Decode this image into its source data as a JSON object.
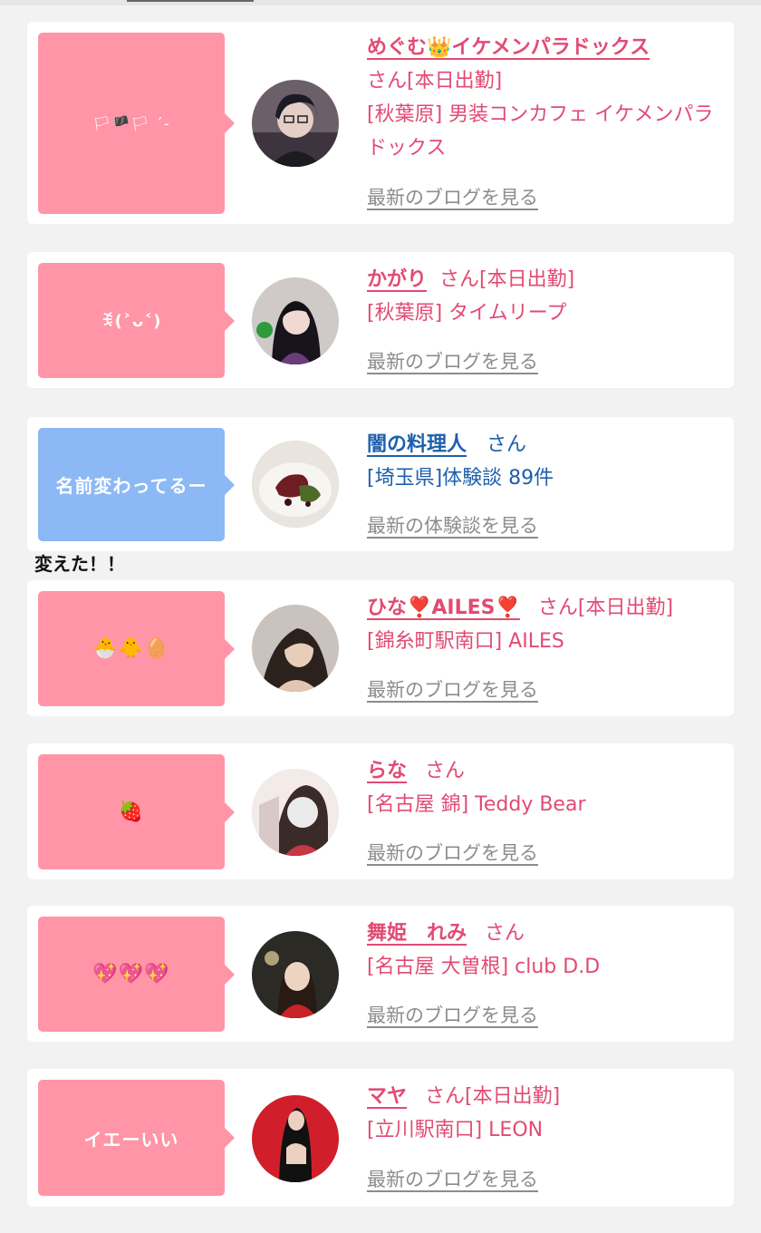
{
  "cards": [
    {
      "bubble_text": "🏳🏴🏳 ´-",
      "bubble_color": "#ff95a6",
      "name": "めぐむ👑イケメンパラドックス",
      "suffix": "さん[本日出勤]",
      "location": "[秋葉原] 男装コンカフェ イケメンパラドックス",
      "link": "最新のブログを見る"
    },
    {
      "bubble_text": "ꉂ(˃ᴗ˂)",
      "bubble_color": "#ff95a6",
      "name": "かがり",
      "suffix": "さん[本日出勤]",
      "location": "[秋葉原] タイムリープ",
      "link": "最新のブログを見る"
    },
    {
      "bubble_text": "名前変わってるー",
      "bubble_color": "#8cb8f5",
      "name": "闇の料理人",
      "suffix": "さん",
      "location": "[埼玉県]体験談 89件",
      "link": "最新の体験談を見る"
    },
    {
      "bubble_text": "🐣🐥🥚",
      "bubble_color": "#ff95a6",
      "name": "ひな❣️AILES❣️",
      "suffix": "さん[本日出勤]",
      "location": "[錦糸町駅南口] AILES",
      "link": "最新のブログを見る"
    },
    {
      "bubble_text": "🍓",
      "bubble_color": "#ff95a6",
      "name": "らな",
      "suffix": "さん",
      "location": "[名古屋 錦] Teddy Bear",
      "link": "最新のブログを見る"
    },
    {
      "bubble_text": "💖💖💖",
      "bubble_color": "#ff95a6",
      "name": "舞姫　れみ",
      "suffix": "さん",
      "location": "[名古屋 大曽根] club D.D",
      "link": "最新のブログを見る"
    },
    {
      "bubble_text": "イエーいい",
      "bubble_color": "#ff95a6",
      "name": "マヤ",
      "suffix": "さん[本日出勤]",
      "location": "[立川駅南口] LEON",
      "link": "最新のブログを見る"
    }
  ],
  "note": "変えた！！",
  "colors": {
    "pink_text": "#e24a74",
    "blue_text": "#1d5fad",
    "link_gray": "#8c8c8c",
    "background": "#f2f2f2"
  }
}
